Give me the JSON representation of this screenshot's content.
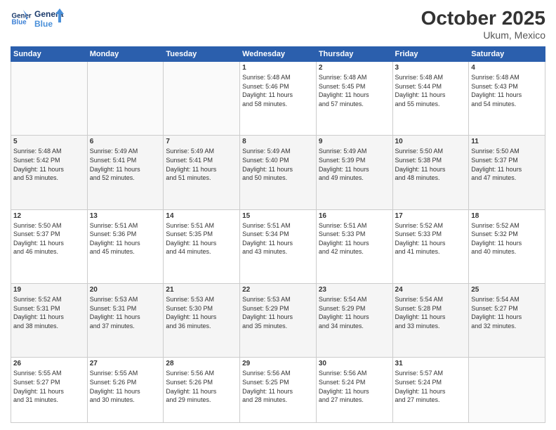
{
  "header": {
    "logo_line1": "General",
    "logo_line2": "Blue",
    "month": "October 2025",
    "location": "Ukum, Mexico"
  },
  "weekdays": [
    "Sunday",
    "Monday",
    "Tuesday",
    "Wednesday",
    "Thursday",
    "Friday",
    "Saturday"
  ],
  "weeks": [
    [
      {
        "day": "",
        "info": ""
      },
      {
        "day": "",
        "info": ""
      },
      {
        "day": "",
        "info": ""
      },
      {
        "day": "1",
        "info": "Sunrise: 5:48 AM\nSunset: 5:46 PM\nDaylight: 11 hours\nand 58 minutes."
      },
      {
        "day": "2",
        "info": "Sunrise: 5:48 AM\nSunset: 5:45 PM\nDaylight: 11 hours\nand 57 minutes."
      },
      {
        "day": "3",
        "info": "Sunrise: 5:48 AM\nSunset: 5:44 PM\nDaylight: 11 hours\nand 55 minutes."
      },
      {
        "day": "4",
        "info": "Sunrise: 5:48 AM\nSunset: 5:43 PM\nDaylight: 11 hours\nand 54 minutes."
      }
    ],
    [
      {
        "day": "5",
        "info": "Sunrise: 5:48 AM\nSunset: 5:42 PM\nDaylight: 11 hours\nand 53 minutes."
      },
      {
        "day": "6",
        "info": "Sunrise: 5:49 AM\nSunset: 5:41 PM\nDaylight: 11 hours\nand 52 minutes."
      },
      {
        "day": "7",
        "info": "Sunrise: 5:49 AM\nSunset: 5:41 PM\nDaylight: 11 hours\nand 51 minutes."
      },
      {
        "day": "8",
        "info": "Sunrise: 5:49 AM\nSunset: 5:40 PM\nDaylight: 11 hours\nand 50 minutes."
      },
      {
        "day": "9",
        "info": "Sunrise: 5:49 AM\nSunset: 5:39 PM\nDaylight: 11 hours\nand 49 minutes."
      },
      {
        "day": "10",
        "info": "Sunrise: 5:50 AM\nSunset: 5:38 PM\nDaylight: 11 hours\nand 48 minutes."
      },
      {
        "day": "11",
        "info": "Sunrise: 5:50 AM\nSunset: 5:37 PM\nDaylight: 11 hours\nand 47 minutes."
      }
    ],
    [
      {
        "day": "12",
        "info": "Sunrise: 5:50 AM\nSunset: 5:37 PM\nDaylight: 11 hours\nand 46 minutes."
      },
      {
        "day": "13",
        "info": "Sunrise: 5:51 AM\nSunset: 5:36 PM\nDaylight: 11 hours\nand 45 minutes."
      },
      {
        "day": "14",
        "info": "Sunrise: 5:51 AM\nSunset: 5:35 PM\nDaylight: 11 hours\nand 44 minutes."
      },
      {
        "day": "15",
        "info": "Sunrise: 5:51 AM\nSunset: 5:34 PM\nDaylight: 11 hours\nand 43 minutes."
      },
      {
        "day": "16",
        "info": "Sunrise: 5:51 AM\nSunset: 5:33 PM\nDaylight: 11 hours\nand 42 minutes."
      },
      {
        "day": "17",
        "info": "Sunrise: 5:52 AM\nSunset: 5:33 PM\nDaylight: 11 hours\nand 41 minutes."
      },
      {
        "day": "18",
        "info": "Sunrise: 5:52 AM\nSunset: 5:32 PM\nDaylight: 11 hours\nand 40 minutes."
      }
    ],
    [
      {
        "day": "19",
        "info": "Sunrise: 5:52 AM\nSunset: 5:31 PM\nDaylight: 11 hours\nand 38 minutes."
      },
      {
        "day": "20",
        "info": "Sunrise: 5:53 AM\nSunset: 5:31 PM\nDaylight: 11 hours\nand 37 minutes."
      },
      {
        "day": "21",
        "info": "Sunrise: 5:53 AM\nSunset: 5:30 PM\nDaylight: 11 hours\nand 36 minutes."
      },
      {
        "day": "22",
        "info": "Sunrise: 5:53 AM\nSunset: 5:29 PM\nDaylight: 11 hours\nand 35 minutes."
      },
      {
        "day": "23",
        "info": "Sunrise: 5:54 AM\nSunset: 5:29 PM\nDaylight: 11 hours\nand 34 minutes."
      },
      {
        "day": "24",
        "info": "Sunrise: 5:54 AM\nSunset: 5:28 PM\nDaylight: 11 hours\nand 33 minutes."
      },
      {
        "day": "25",
        "info": "Sunrise: 5:54 AM\nSunset: 5:27 PM\nDaylight: 11 hours\nand 32 minutes."
      }
    ],
    [
      {
        "day": "26",
        "info": "Sunrise: 5:55 AM\nSunset: 5:27 PM\nDaylight: 11 hours\nand 31 minutes."
      },
      {
        "day": "27",
        "info": "Sunrise: 5:55 AM\nSunset: 5:26 PM\nDaylight: 11 hours\nand 30 minutes."
      },
      {
        "day": "28",
        "info": "Sunrise: 5:56 AM\nSunset: 5:26 PM\nDaylight: 11 hours\nand 29 minutes."
      },
      {
        "day": "29",
        "info": "Sunrise: 5:56 AM\nSunset: 5:25 PM\nDaylight: 11 hours\nand 28 minutes."
      },
      {
        "day": "30",
        "info": "Sunrise: 5:56 AM\nSunset: 5:24 PM\nDaylight: 11 hours\nand 27 minutes."
      },
      {
        "day": "31",
        "info": "Sunrise: 5:57 AM\nSunset: 5:24 PM\nDaylight: 11 hours\nand 27 minutes."
      },
      {
        "day": "",
        "info": ""
      }
    ]
  ]
}
